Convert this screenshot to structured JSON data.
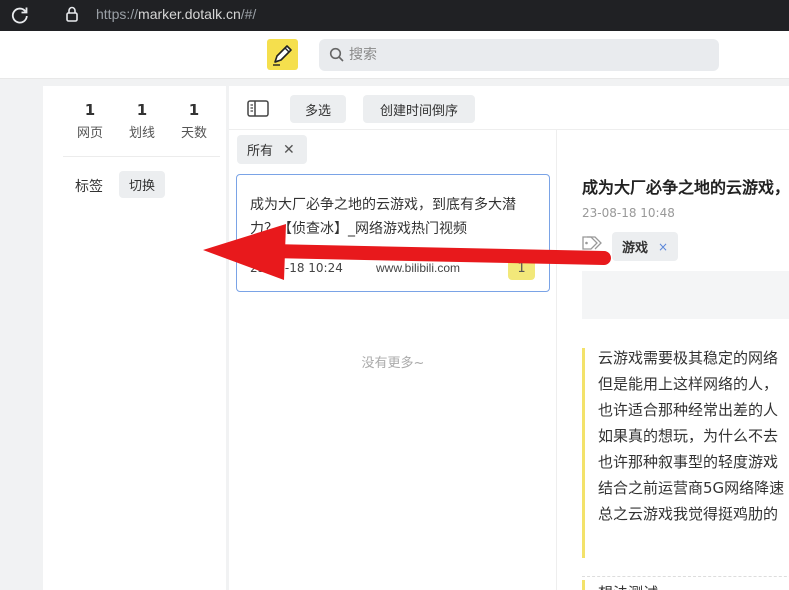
{
  "browser": {
    "url_protocol": "https://",
    "url_host": "marker.dotalk.cn",
    "url_path": "/#/"
  },
  "header": {
    "logo_icon": "pen-icon",
    "search_placeholder": "搜索"
  },
  "stats": [
    {
      "value": "1",
      "label": "网页"
    },
    {
      "value": "1",
      "label": "划线"
    },
    {
      "value": "1",
      "label": "天数"
    }
  ],
  "tags": {
    "label": "标签",
    "switch_label": "切换"
  },
  "toolbar": {
    "multi_select_label": "多选",
    "sort_label": "创建时间倒序"
  },
  "filter": {
    "chip_label": "所有",
    "close_glyph": "✕"
  },
  "list": {
    "items": [
      {
        "title": "成为大厂必争之地的云游戏，到底有多大潜力？【侦查冰】_网络游戏热门视频",
        "time": "23-08-18 10:24",
        "site": "www.bilibili.com",
        "count": "1"
      }
    ],
    "no_more": "没有更多~"
  },
  "detail": {
    "title": "成为大厂必争之地的云游戏，到底有多大潜力？",
    "date": "23-08-18 10:48",
    "tag": "游戏",
    "tag_close": "×",
    "highlight_lines": [
      "云游戏需要极其稳定的网络",
      "但是能用上这样网络的人，",
      "也许适合那种经常出差的人",
      "如果真的想玩，为什么不去",
      "也许那种叙事型的轻度游戏",
      "结合之前运营商5G网络降速",
      "总之云游戏我觉得挺鸡肋的"
    ],
    "thought": "想法测试"
  },
  "annotation": {
    "arrow_color": "#e8191c"
  }
}
